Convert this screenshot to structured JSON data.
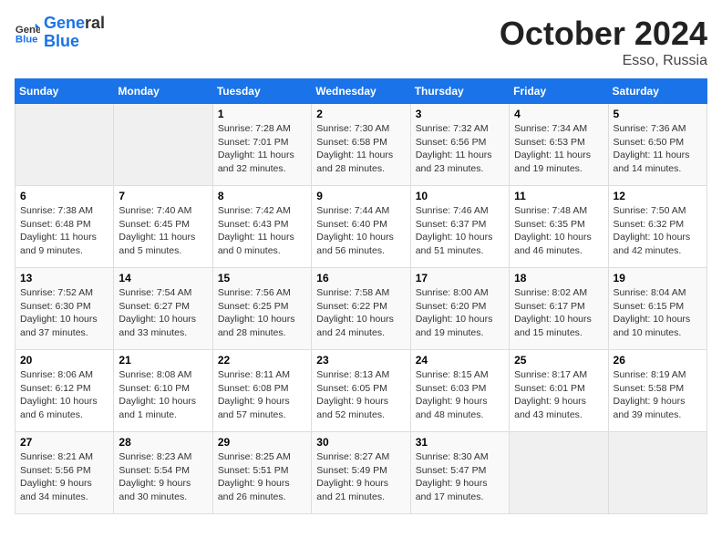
{
  "header": {
    "logo_line1": "General",
    "logo_line2": "Blue",
    "month": "October 2024",
    "location": "Esso, Russia"
  },
  "weekdays": [
    "Sunday",
    "Monday",
    "Tuesday",
    "Wednesday",
    "Thursday",
    "Friday",
    "Saturday"
  ],
  "weeks": [
    [
      {
        "day": null,
        "info": null
      },
      {
        "day": null,
        "info": null
      },
      {
        "day": "1",
        "info": "Sunrise: 7:28 AM\nSunset: 7:01 PM\nDaylight: 11 hours\nand 32 minutes."
      },
      {
        "day": "2",
        "info": "Sunrise: 7:30 AM\nSunset: 6:58 PM\nDaylight: 11 hours\nand 28 minutes."
      },
      {
        "day": "3",
        "info": "Sunrise: 7:32 AM\nSunset: 6:56 PM\nDaylight: 11 hours\nand 23 minutes."
      },
      {
        "day": "4",
        "info": "Sunrise: 7:34 AM\nSunset: 6:53 PM\nDaylight: 11 hours\nand 19 minutes."
      },
      {
        "day": "5",
        "info": "Sunrise: 7:36 AM\nSunset: 6:50 PM\nDaylight: 11 hours\nand 14 minutes."
      }
    ],
    [
      {
        "day": "6",
        "info": "Sunrise: 7:38 AM\nSunset: 6:48 PM\nDaylight: 11 hours\nand 9 minutes."
      },
      {
        "day": "7",
        "info": "Sunrise: 7:40 AM\nSunset: 6:45 PM\nDaylight: 11 hours\nand 5 minutes."
      },
      {
        "day": "8",
        "info": "Sunrise: 7:42 AM\nSunset: 6:43 PM\nDaylight: 11 hours\nand 0 minutes."
      },
      {
        "day": "9",
        "info": "Sunrise: 7:44 AM\nSunset: 6:40 PM\nDaylight: 10 hours\nand 56 minutes."
      },
      {
        "day": "10",
        "info": "Sunrise: 7:46 AM\nSunset: 6:37 PM\nDaylight: 10 hours\nand 51 minutes."
      },
      {
        "day": "11",
        "info": "Sunrise: 7:48 AM\nSunset: 6:35 PM\nDaylight: 10 hours\nand 46 minutes."
      },
      {
        "day": "12",
        "info": "Sunrise: 7:50 AM\nSunset: 6:32 PM\nDaylight: 10 hours\nand 42 minutes."
      }
    ],
    [
      {
        "day": "13",
        "info": "Sunrise: 7:52 AM\nSunset: 6:30 PM\nDaylight: 10 hours\nand 37 minutes."
      },
      {
        "day": "14",
        "info": "Sunrise: 7:54 AM\nSunset: 6:27 PM\nDaylight: 10 hours\nand 33 minutes."
      },
      {
        "day": "15",
        "info": "Sunrise: 7:56 AM\nSunset: 6:25 PM\nDaylight: 10 hours\nand 28 minutes."
      },
      {
        "day": "16",
        "info": "Sunrise: 7:58 AM\nSunset: 6:22 PM\nDaylight: 10 hours\nand 24 minutes."
      },
      {
        "day": "17",
        "info": "Sunrise: 8:00 AM\nSunset: 6:20 PM\nDaylight: 10 hours\nand 19 minutes."
      },
      {
        "day": "18",
        "info": "Sunrise: 8:02 AM\nSunset: 6:17 PM\nDaylight: 10 hours\nand 15 minutes."
      },
      {
        "day": "19",
        "info": "Sunrise: 8:04 AM\nSunset: 6:15 PM\nDaylight: 10 hours\nand 10 minutes."
      }
    ],
    [
      {
        "day": "20",
        "info": "Sunrise: 8:06 AM\nSunset: 6:12 PM\nDaylight: 10 hours\nand 6 minutes."
      },
      {
        "day": "21",
        "info": "Sunrise: 8:08 AM\nSunset: 6:10 PM\nDaylight: 10 hours\nand 1 minute."
      },
      {
        "day": "22",
        "info": "Sunrise: 8:11 AM\nSunset: 6:08 PM\nDaylight: 9 hours\nand 57 minutes."
      },
      {
        "day": "23",
        "info": "Sunrise: 8:13 AM\nSunset: 6:05 PM\nDaylight: 9 hours\nand 52 minutes."
      },
      {
        "day": "24",
        "info": "Sunrise: 8:15 AM\nSunset: 6:03 PM\nDaylight: 9 hours\nand 48 minutes."
      },
      {
        "day": "25",
        "info": "Sunrise: 8:17 AM\nSunset: 6:01 PM\nDaylight: 9 hours\nand 43 minutes."
      },
      {
        "day": "26",
        "info": "Sunrise: 8:19 AM\nSunset: 5:58 PM\nDaylight: 9 hours\nand 39 minutes."
      }
    ],
    [
      {
        "day": "27",
        "info": "Sunrise: 8:21 AM\nSunset: 5:56 PM\nDaylight: 9 hours\nand 34 minutes."
      },
      {
        "day": "28",
        "info": "Sunrise: 8:23 AM\nSunset: 5:54 PM\nDaylight: 9 hours\nand 30 minutes."
      },
      {
        "day": "29",
        "info": "Sunrise: 8:25 AM\nSunset: 5:51 PM\nDaylight: 9 hours\nand 26 minutes."
      },
      {
        "day": "30",
        "info": "Sunrise: 8:27 AM\nSunset: 5:49 PM\nDaylight: 9 hours\nand 21 minutes."
      },
      {
        "day": "31",
        "info": "Sunrise: 8:30 AM\nSunset: 5:47 PM\nDaylight: 9 hours\nand 17 minutes."
      },
      {
        "day": null,
        "info": null
      },
      {
        "day": null,
        "info": null
      }
    ]
  ]
}
